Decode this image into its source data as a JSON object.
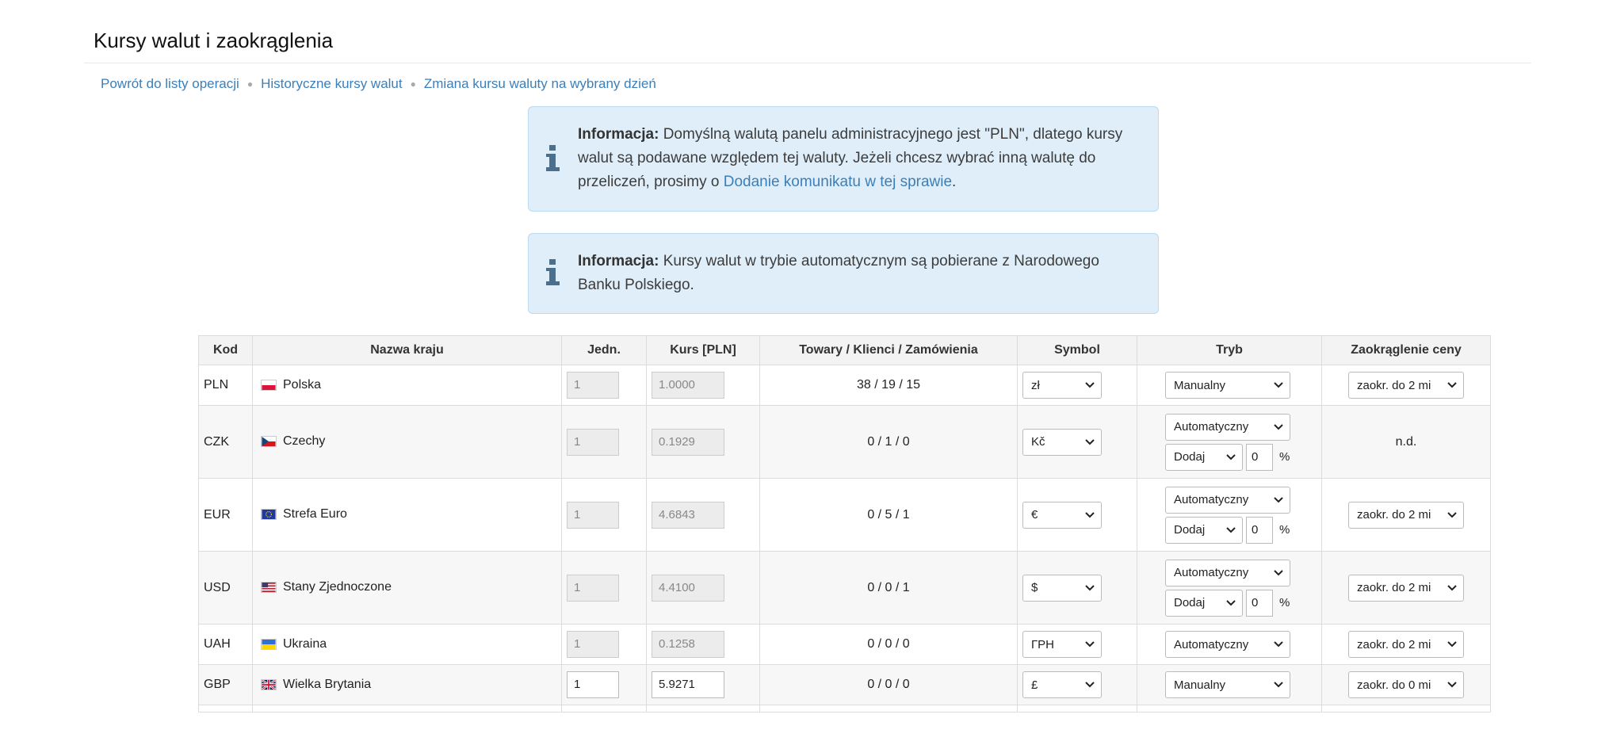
{
  "page": {
    "title": "Kursy walut i zaokrąglenia"
  },
  "breadcrumb": [
    {
      "label": "Powrót do listy operacji"
    },
    {
      "label": "Historyczne kursy walut"
    },
    {
      "label": "Zmiana kursu waluty na wybrany dzień"
    }
  ],
  "alerts": [
    {
      "label": "Informacja:",
      "text": " Domyślną walutą panelu administracyjnego jest \"PLN\", dlatego kursy walut są podawane względem tej waluty. Jeżeli chcesz wybrać inną walutę do przeliczeń, prosimy o ",
      "link": "Dodanie komunikatu w tej sprawie",
      "after": "."
    },
    {
      "label": "Informacja:",
      "text": " Kursy walut w trybie automatycznym są pobierane z Narodowego Banku Polskiego."
    }
  ],
  "table": {
    "headers": [
      "Kod",
      "Nazwa kraju",
      "Jedn.",
      "Kurs [PLN]",
      "Towary / Klienci / Zamówienia",
      "Symbol",
      "Tryb",
      "Zaokrąglenie ceny"
    ],
    "rows": [
      {
        "code": "PLN",
        "country": "Polska",
        "flag": "pl",
        "unit": "1",
        "rate": "1.0000",
        "counts": "38 / 19 / 15",
        "symbol": "zł",
        "mode": "Manualny",
        "rounding": "zaokr. do 2 mi"
      },
      {
        "code": "CZK",
        "country": "Czechy",
        "flag": "cz",
        "unit": "1",
        "rate": "0.1929",
        "counts": "0 / 1 / 0",
        "symbol": "Kč",
        "mode": "Automatyczny",
        "adjust": "Dodaj",
        "percent": "0",
        "percent_sign": "%",
        "rounding_text": "n.d."
      },
      {
        "code": "EUR",
        "country": "Strefa Euro",
        "flag": "eu",
        "unit": "1",
        "rate": "4.6843",
        "counts": "0 / 5 / 1",
        "symbol": "€",
        "mode": "Automatyczny",
        "adjust": "Dodaj",
        "percent": "0",
        "percent_sign": "%",
        "rounding": "zaokr. do 2 mi"
      },
      {
        "code": "USD",
        "country": "Stany Zjednoczone",
        "flag": "us",
        "unit": "1",
        "rate": "4.4100",
        "counts": "0 / 0 / 1",
        "symbol": "$",
        "mode": "Automatyczny",
        "adjust": "Dodaj",
        "percent": "0",
        "percent_sign": "%",
        "rounding": "zaokr. do 2 mi"
      },
      {
        "code": "UAH",
        "country": "Ukraina",
        "flag": "ua",
        "unit": "1",
        "rate": "0.1258",
        "counts": "0 / 0 / 0",
        "symbol": "ГРН",
        "mode": "Automatyczny",
        "rounding": "zaokr. do 2 mi"
      },
      {
        "code": "GBP",
        "country": "Wielka Brytania",
        "flag": "gb",
        "unit": "1",
        "rate": "5.9271",
        "counts": "0 / 0 / 0",
        "symbol": "£",
        "mode": "Manualny",
        "rounding": "zaokr. do 0 mi"
      }
    ]
  },
  "colors": {
    "link": "#3c7fb8",
    "alert_bg": "#dfeef8",
    "alert_border": "#b9dcf2",
    "icon": "#4a6f8e"
  }
}
